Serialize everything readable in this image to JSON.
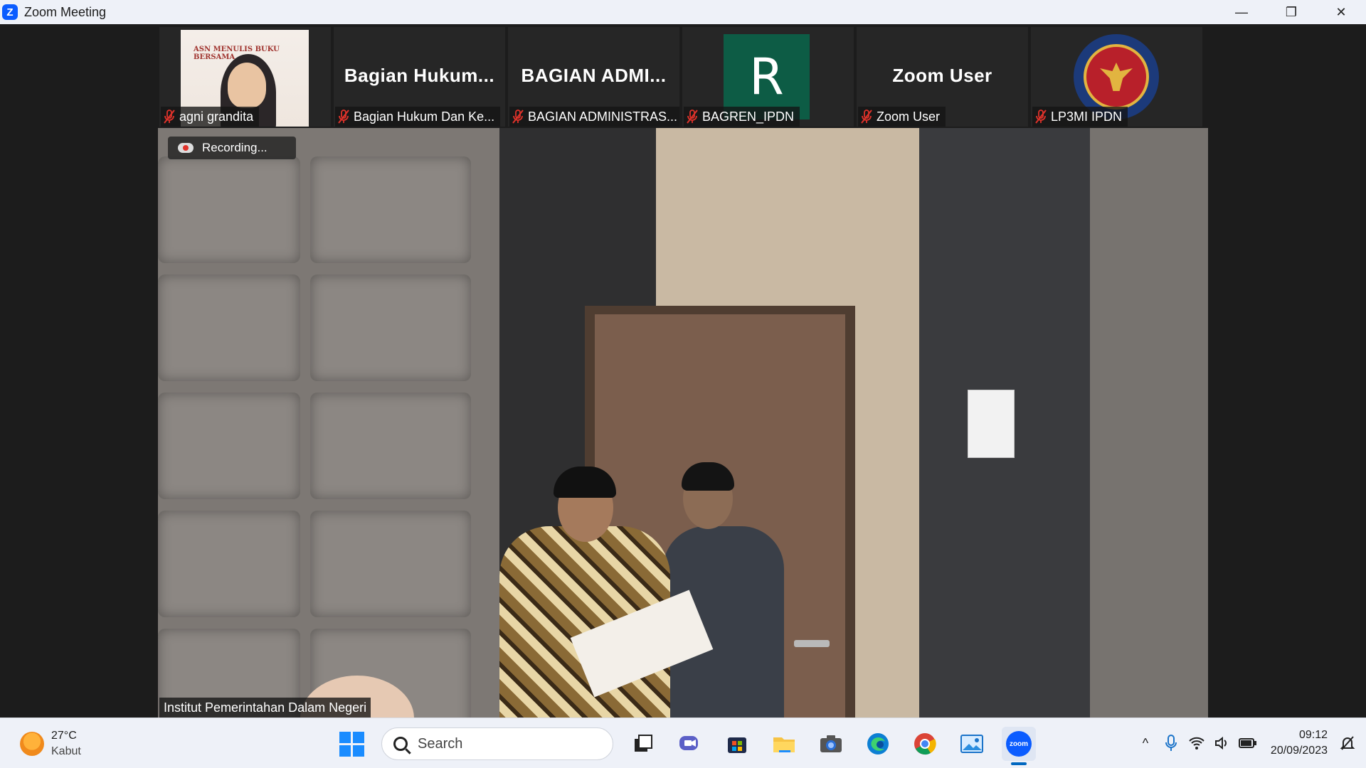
{
  "window": {
    "title": "Zoom Meeting",
    "app_icon_letter": "Z",
    "minimize_glyph": "—",
    "restore_glyph": "❐",
    "close_glyph": "✕"
  },
  "participants": [
    {
      "big_name": "",
      "label": "agni grandita",
      "tile": "camera",
      "banner": "ASN MENULIS BUKU BERSAMA"
    },
    {
      "big_name": "Bagian  Hukum...",
      "label": "Bagian Hukum Dan Ke...",
      "tile": "name"
    },
    {
      "big_name": "BAGIAN  ADMI...",
      "label": "BAGIAN ADMINISTRAS...",
      "tile": "name"
    },
    {
      "big_name": "",
      "label": "BAGREN_IPDN",
      "tile": "avatar",
      "avatar_letter": "R",
      "avatar_color": "#0d5c45"
    },
    {
      "big_name": "Zoom User",
      "label": "Zoom User",
      "tile": "name"
    },
    {
      "big_name": "",
      "label": "LP3MI IPDN",
      "tile": "logo"
    }
  ],
  "main_video": {
    "recording_text": "Recording...",
    "speaker_label": "Institut Pemerintahan Dalam Negeri"
  },
  "taskbar": {
    "weather_temp": "27°C",
    "weather_desc": "Kabut",
    "search_placeholder": "Search",
    "zoom_label": "zoom",
    "time": "09:12",
    "date": "20/09/2023",
    "tray_chevron": "^"
  },
  "colors": {
    "accent": "#0b5cff",
    "muted_red": "#e0322a"
  }
}
